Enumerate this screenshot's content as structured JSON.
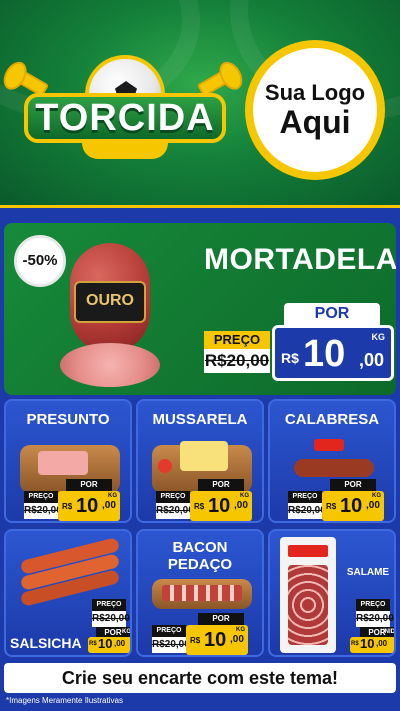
{
  "header": {
    "badge_text": "TORCIDA",
    "logo_line1": "Sua Logo",
    "logo_line2": "Aqui"
  },
  "featured": {
    "discount": "-50%",
    "name": "MORTADELA",
    "brand_label": "OURO",
    "por_label": "POR",
    "preco_label": "PREÇO",
    "old_price": "R$20,00",
    "currency": "R$",
    "price_int": "10",
    "price_dec": ",00",
    "unit": "KG"
  },
  "products": [
    {
      "name": "PRESUNTO",
      "preco_label": "PREÇO",
      "por_label": "POR",
      "old_price": "R$20,00",
      "currency": "R$",
      "price_int": "10",
      "price_dec": ",00",
      "unit": "KG"
    },
    {
      "name": "MUSSARELA",
      "preco_label": "PREÇO",
      "por_label": "POR",
      "old_price": "R$20,00",
      "currency": "R$",
      "price_int": "10",
      "price_dec": ",00",
      "unit": "KG"
    },
    {
      "name": "CALABRESA",
      "preco_label": "PREÇO",
      "por_label": "POR",
      "old_price": "R$20,00",
      "currency": "R$",
      "price_int": "10",
      "price_dec": ",00",
      "unit": "KG"
    },
    {
      "name": "SALSICHA",
      "preco_label": "PREÇO",
      "por_label": "POR",
      "old_price": "R$20,00",
      "currency": "R$",
      "price_int": "10",
      "price_dec": ",00",
      "unit": "KG"
    },
    {
      "name_line1": "BACON",
      "name_line2": "PEDAÇO",
      "preco_label": "PREÇO",
      "por_label": "POR",
      "old_price": "R$20,00",
      "currency": "R$",
      "price_int": "10",
      "price_dec": ",00",
      "unit": "KG"
    },
    {
      "name": "SALAME",
      "preco_label": "PREÇO",
      "por_label": "POR",
      "old_price": "R$20,00",
      "currency": "R$",
      "price_int": "10",
      "price_dec": ",00",
      "unit": "UNID"
    }
  ],
  "cta_text": "Crie seu encarte com este tema!",
  "disclaimer": "*Imagens Meramente Ilustrativas",
  "colors": {
    "green": "#14803a",
    "blue": "#1c3aa9",
    "yellow": "#f6c700"
  }
}
